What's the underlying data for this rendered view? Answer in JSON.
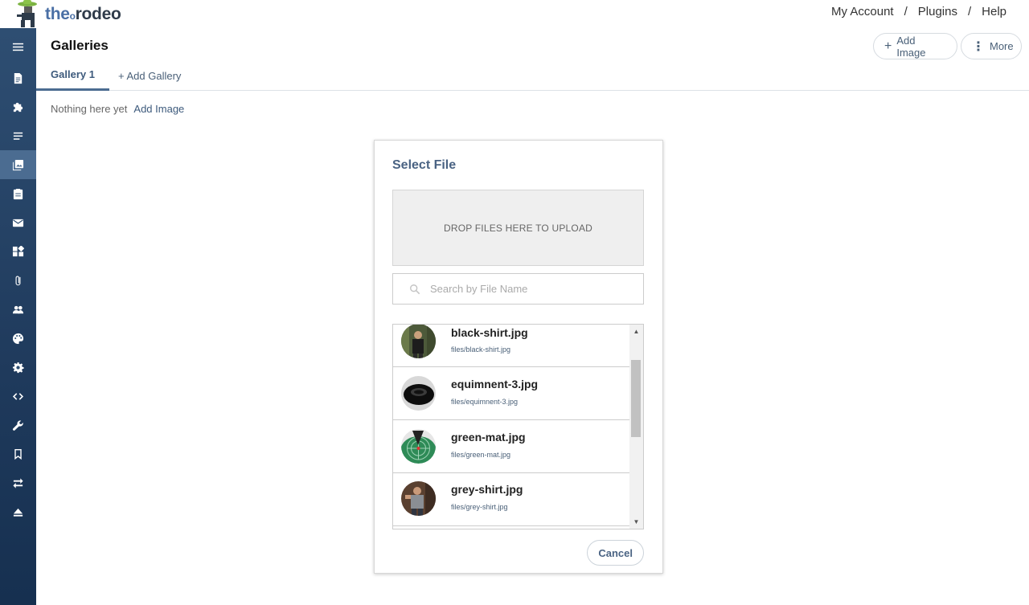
{
  "brand": {
    "logo_prefix": "the",
    "logo_dot": "o",
    "logo_suffix": "rodeo"
  },
  "topnav": {
    "my_account": "My Account",
    "plugins": "Plugins",
    "help": "Help",
    "separator": "/"
  },
  "sidebar": {
    "items": [
      {
        "icon": "menu-icon"
      },
      {
        "icon": "page-icon"
      },
      {
        "icon": "puzzle-icon"
      },
      {
        "icon": "text-lines-icon"
      },
      {
        "icon": "gallery-icon",
        "active": true
      },
      {
        "icon": "clipboard-icon"
      },
      {
        "icon": "mail-icon"
      },
      {
        "icon": "widgets-icon"
      },
      {
        "icon": "paperclip-icon"
      },
      {
        "icon": "people-icon"
      },
      {
        "icon": "palette-icon"
      },
      {
        "icon": "gear-icon"
      },
      {
        "icon": "code-icon"
      },
      {
        "icon": "wrench-icon"
      },
      {
        "icon": "bookmark-icon"
      },
      {
        "icon": "swap-arrows-icon"
      },
      {
        "icon": "eject-icon"
      }
    ]
  },
  "header": {
    "title": "Galleries",
    "add_image_button": "Add Image",
    "more_button": "More"
  },
  "tabs": {
    "active": "Gallery 1",
    "add": "+ Add Gallery"
  },
  "empty_state": {
    "text": "Nothing here yet",
    "link": "Add Image"
  },
  "modal": {
    "title": "Select File",
    "dropzone": "DROP FILES HERE TO UPLOAD",
    "search_placeholder": "Search by File Name",
    "search_value": "",
    "files": [
      {
        "name": "black-shirt.jpg",
        "path": "files/black-shirt.jpg"
      },
      {
        "name": "equimnent-3.jpg",
        "path": "files/equimnent-3.jpg"
      },
      {
        "name": "green-mat.jpg",
        "path": "files/green-mat.jpg"
      },
      {
        "name": "grey-shirt.jpg",
        "path": "files/grey-shirt.jpg"
      }
    ],
    "cancel": "Cancel"
  },
  "colors": {
    "sidebar": "#1f3a5c",
    "sidebar_active": "#4b6c91",
    "accent": "#4a6383"
  }
}
